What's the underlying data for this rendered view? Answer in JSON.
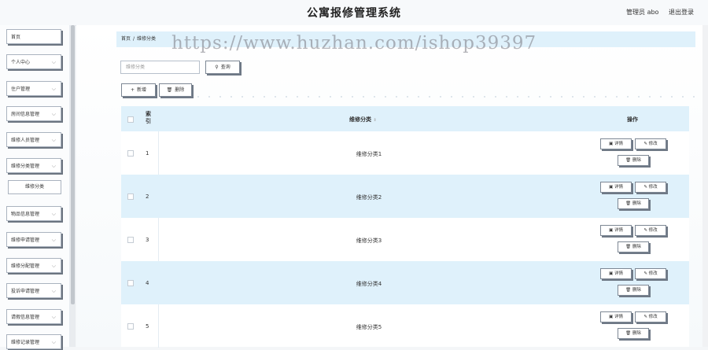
{
  "header": {
    "title": "公寓报修管理系统",
    "user_label": "管理员 abo",
    "logout_label": "退出登录"
  },
  "sidebar": {
    "items": [
      {
        "label": "首页",
        "has_chevron": false
      },
      {
        "label": "个人中心",
        "has_chevron": true
      },
      {
        "label": "住户管理",
        "has_chevron": true
      },
      {
        "label": "房间信息管理",
        "has_chevron": true
      },
      {
        "label": "维修人员管理",
        "has_chevron": true
      },
      {
        "label": "维修分类管理",
        "has_chevron": true
      },
      {
        "label": "维修分类",
        "sub": true
      },
      {
        "label": "物品信息管理",
        "has_chevron": true
      },
      {
        "label": "维修申请管理",
        "has_chevron": true
      },
      {
        "label": "维修分配管理",
        "has_chevron": true
      },
      {
        "label": "投诉申请管理",
        "has_chevron": true
      },
      {
        "label": "请假信息管理",
        "has_chevron": true
      },
      {
        "label": "维修记录管理",
        "has_chevron": true
      }
    ]
  },
  "breadcrumb": {
    "home": "首页",
    "separator": "/",
    "current": "维修分类"
  },
  "watermark": "https://www.huzhan.com/ishop39397",
  "search": {
    "placeholder": "维修分类",
    "button_label": "查询",
    "button_icon": "search-icon"
  },
  "toolbar": {
    "add_label": "新增",
    "delete_label": "删除"
  },
  "table": {
    "columns": {
      "index": "索引",
      "name": "维修分类",
      "actions": "操作"
    },
    "rows": [
      {
        "index": "1",
        "name": "维修分类1"
      },
      {
        "index": "2",
        "name": "维修分类2"
      },
      {
        "index": "3",
        "name": "维修分类3"
      },
      {
        "index": "4",
        "name": "维修分类4"
      },
      {
        "index": "5",
        "name": "维修分类5"
      }
    ],
    "actions": {
      "detail": "详情",
      "edit": "修改",
      "delete": "删除"
    }
  },
  "colors": {
    "accent": "#dff1fb",
    "border": "#7d8794"
  }
}
